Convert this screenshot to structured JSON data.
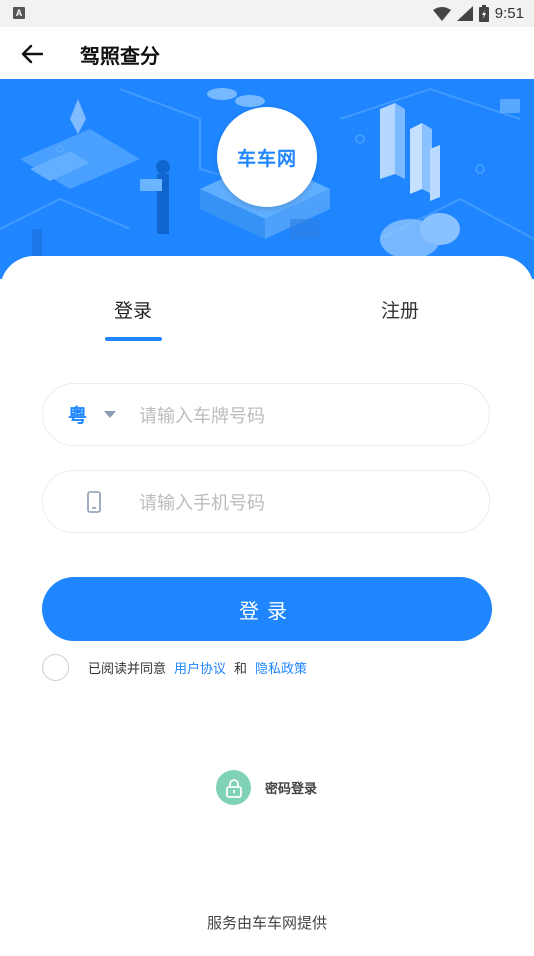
{
  "status_bar": {
    "left_icon": "A",
    "time": "9:51",
    "icons": [
      "wifi-icon",
      "signal-icon",
      "battery-icon"
    ]
  },
  "app_bar": {
    "title": "驾照查分",
    "back_icon": "arrow-left-icon"
  },
  "banner": {
    "logo_text": "车车网",
    "background_color": "#1f86ff"
  },
  "tabs": [
    {
      "label": "登录",
      "active": true
    },
    {
      "label": "注册",
      "active": false
    }
  ],
  "form": {
    "plate": {
      "province": "粤",
      "placeholder": "请输入车牌号码"
    },
    "phone": {
      "placeholder": "请输入手机号码",
      "icon": "phone-icon"
    },
    "submit_label": "登录"
  },
  "agreement": {
    "prefix": "已阅读并同意",
    "user_agreement": "用户协议",
    "and": "和",
    "privacy_policy": "隐私政策"
  },
  "password_login": {
    "label": "密码登录",
    "icon": "lock-icon"
  },
  "footer": {
    "text": "服务由车车网提供"
  },
  "colors": {
    "accent": "#1f86ff",
    "lock_green": "#7fd3b4"
  }
}
